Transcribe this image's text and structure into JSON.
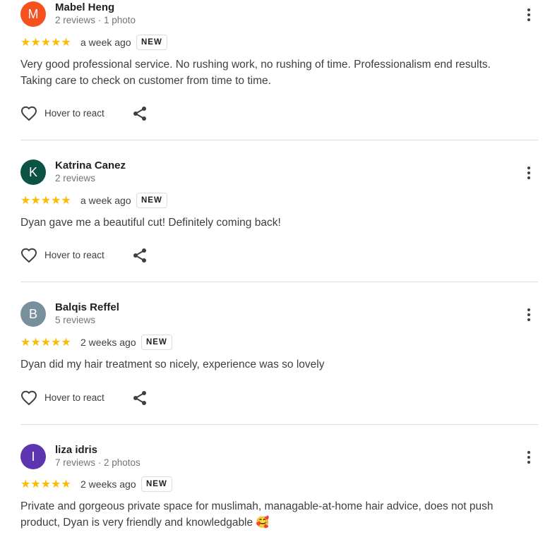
{
  "reviews": [
    {
      "initial": "M",
      "avatar_color": "#f4511e",
      "name": "Mabel Heng",
      "meta": "2 reviews · 1 photo",
      "stars": "★★★★★",
      "rating": 5,
      "date": "a week ago",
      "badge": "NEW",
      "text": "Very good professional service. No rushing work, no rushing of time. Professionalism end results. Taking care to check on customer from time to time.",
      "react_label": "Hover to react"
    },
    {
      "initial": "K",
      "avatar_color": "#0b5345",
      "name": "Katrina Canez",
      "meta": "2 reviews",
      "stars": "★★★★★",
      "rating": 5,
      "date": "a week ago",
      "badge": "NEW",
      "text": "Dyan gave me a beautiful cut! Definitely coming back!",
      "react_label": "Hover to react"
    },
    {
      "initial": "B",
      "avatar_color": "#78909c",
      "name": "Balqis Reffel",
      "meta": "5 reviews",
      "stars": "★★★★★",
      "rating": 5,
      "date": "2 weeks ago",
      "badge": "NEW",
      "text": "Dyan did my hair treatment so nicely, experience was so lovely",
      "react_label": "Hover to react"
    },
    {
      "initial": "I",
      "avatar_color": "#5e35b1",
      "name": "liza idris",
      "meta": "7 reviews · 2 photos",
      "stars": "★★★★★",
      "rating": 5,
      "date": "2 weeks ago",
      "badge": "NEW",
      "text": "Private and gorgeous private space for muslimah, managable-at-home hair advice, does not push product, Dyan is very friendly and knowledgable 🥰"
    }
  ]
}
